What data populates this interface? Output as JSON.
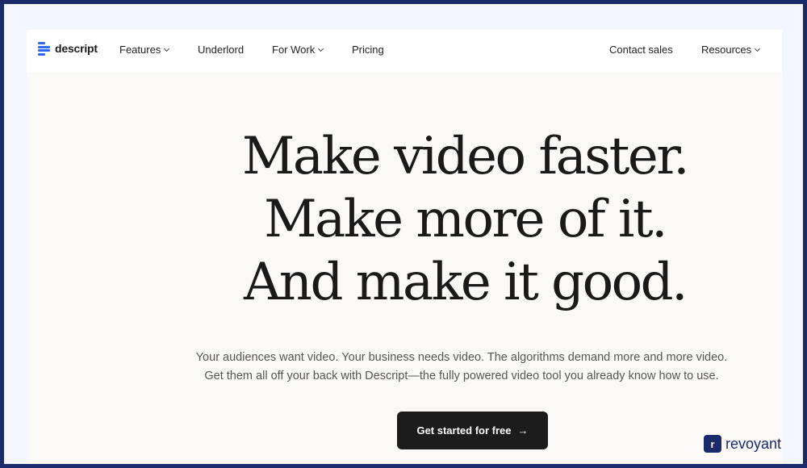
{
  "brand": {
    "name": "descript",
    "accent": "#2b6bf3"
  },
  "nav": {
    "left_items": [
      {
        "label": "Features",
        "dropdown": true
      },
      {
        "label": "Underlord",
        "dropdown": false
      },
      {
        "label": "For Work",
        "dropdown": true
      },
      {
        "label": "Pricing",
        "dropdown": false
      }
    ],
    "right_items": [
      {
        "label": "Contact sales",
        "dropdown": false
      },
      {
        "label": "Resources",
        "dropdown": true
      }
    ],
    "chevron_icon": "chevron-down-icon"
  },
  "hero": {
    "headline_lines": [
      "Make video faster.",
      "Make more of it.",
      "And make it good."
    ],
    "subtitle_lines": [
      "Your audiences want video. Your business needs video. The algorithms demand more and more video.",
      "Get them all off your back with Descript—the fully powered video tool you already know how to use."
    ],
    "cta_label": "Get started for free",
    "cta_icon": "arrow-right-icon",
    "cta_color": "#1c1c1c"
  },
  "watermark": {
    "mark": "r",
    "text": "revoyant",
    "color": "#1b2a6b"
  }
}
